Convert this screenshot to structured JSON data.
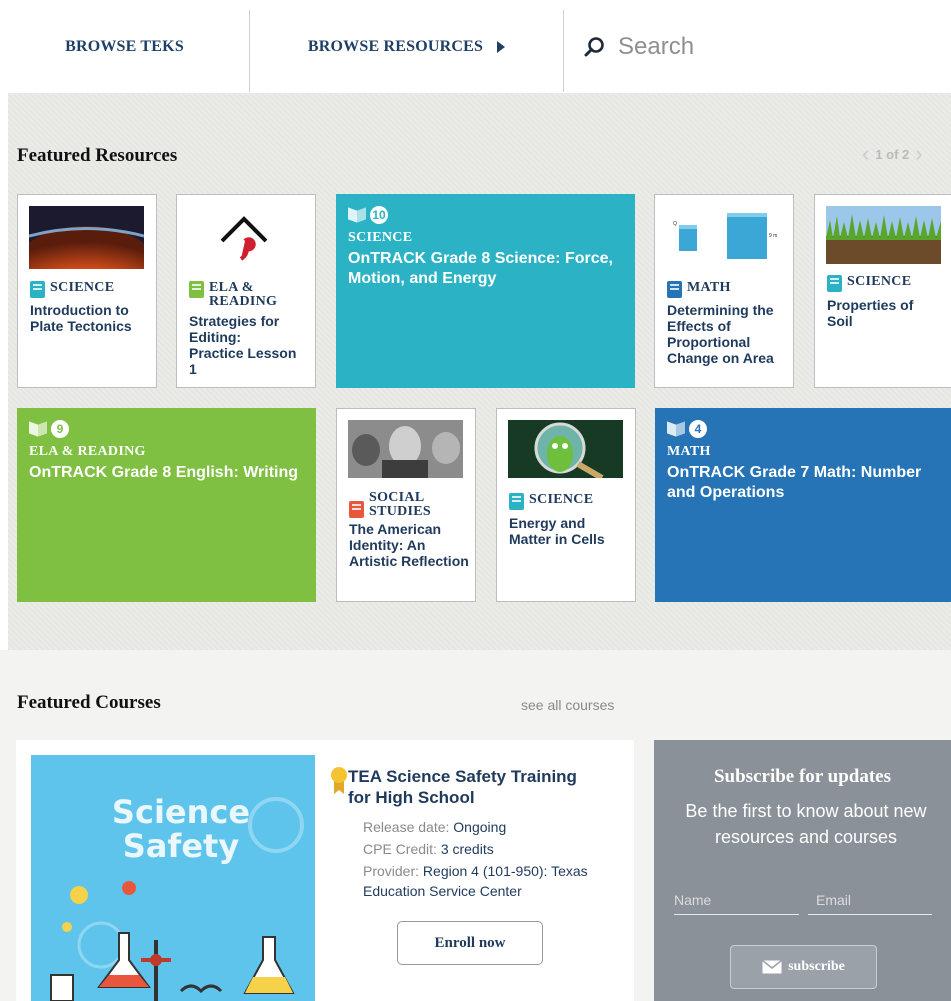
{
  "nav": {
    "browse_teks": "BROWSE TEKS",
    "browse_resources": "BROWSE RESOURCES",
    "search_placeholder": "Search"
  },
  "featured": {
    "title": "Featured Resources",
    "pager": "1 of 2",
    "cards": [
      {
        "subject": "SCIENCE",
        "title": "Introduction to Plate Tectonics"
      },
      {
        "subject": "ELA & READING",
        "title": "Strategies for Editing: Practice Lesson 1"
      },
      {
        "subject": "SCIENCE",
        "title": "OnTRACK Grade 8 Science: Force, Motion, and Energy",
        "count": "10"
      },
      {
        "subject": "MATH",
        "title": "Determining the Effects of Proportional Change on Area"
      },
      {
        "subject": "SCIENCE",
        "title": "Properties of Soil"
      },
      {
        "subject": "ELA & READING",
        "title": "OnTRACK Grade 8 English: Writing",
        "count": "9"
      },
      {
        "subject": "SOCIAL STUDIES",
        "title": "The American Identity: An Artistic Reflection"
      },
      {
        "subject": "SCIENCE",
        "title": "Energy and Matter in Cells"
      },
      {
        "subject": "MATH",
        "title": "OnTRACK Grade 7 Math: Number and Operations",
        "count": "4"
      }
    ]
  },
  "courses": {
    "title": "Featured Courses",
    "see_all": "see all courses",
    "course": {
      "image_text": "Science Safety",
      "title": "TEA Science Safety Training for High School",
      "release_label": "Release date:",
      "release_value": "Ongoing",
      "cpe_label": "CPE Credit:",
      "cpe_value": "3 credits",
      "provider_label": "Provider:",
      "provider_value": "Region 4 (101-950): Texas Education Service Center",
      "enroll": "Enroll now"
    }
  },
  "subscribe": {
    "title": "Subscribe for updates",
    "text": "Be the first to know about new resources and courses",
    "name_placeholder": "Name",
    "email_placeholder": "Email",
    "button": "subscribe"
  },
  "colors": {
    "science_teal": "#2bb3c5",
    "ela_green": "#7fc043",
    "math_blue": "#2674b5",
    "social_red": "#e8573d",
    "navy_text": "#1f3a5c"
  }
}
